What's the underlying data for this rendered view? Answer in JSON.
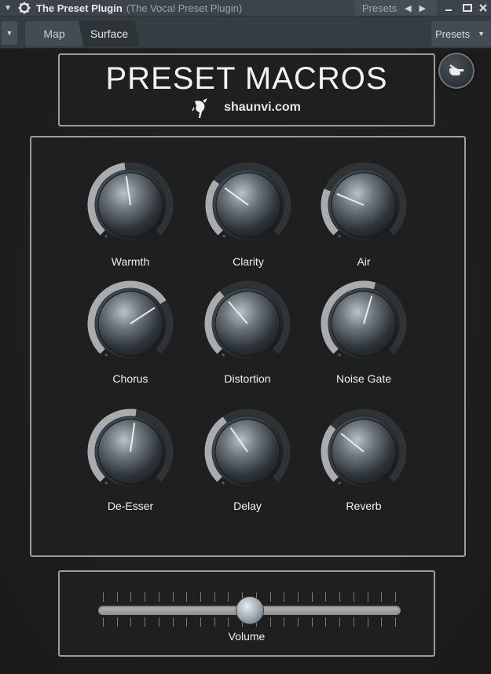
{
  "titlebar": {
    "title": "The Preset Plugin",
    "subtitle": "(The Vocal Preset Plugin)",
    "presets_label": "Presets",
    "icons": [
      "menu-arrow-icon",
      "gear-icon",
      "prev-arrow-icon",
      "next-arrow-icon",
      "minimize-icon",
      "maximize-icon",
      "close-icon"
    ]
  },
  "tabs": [
    {
      "label": "Map",
      "active": false
    },
    {
      "label": "Surface",
      "active": true
    }
  ],
  "tabbar": {
    "presets_label": "Presets"
  },
  "header": {
    "title": "PRESET MACROS",
    "site": "shaunvi.com"
  },
  "knobs": [
    {
      "label": "Warmth",
      "value": 0.47
    },
    {
      "label": "Clarity",
      "value": 0.3
    },
    {
      "label": "Air",
      "value": 0.25
    },
    {
      "label": "Chorus",
      "value": 0.71
    },
    {
      "label": "Distortion",
      "value": 0.35
    },
    {
      "label": "Noise Gate",
      "value": 0.56
    },
    {
      "label": "De-Esser",
      "value": 0.53
    },
    {
      "label": "Delay",
      "value": 0.37
    },
    {
      "label": "Reverb",
      "value": 0.31
    }
  ],
  "volume": {
    "label": "Volume",
    "value": 0.5
  },
  "colors": {
    "background": "#1e1e1e",
    "frame": "#9c9c9c",
    "arc_active": "#a8acaf",
    "arc_inactive": "#2e3336",
    "titlebar": "#3c4449"
  }
}
